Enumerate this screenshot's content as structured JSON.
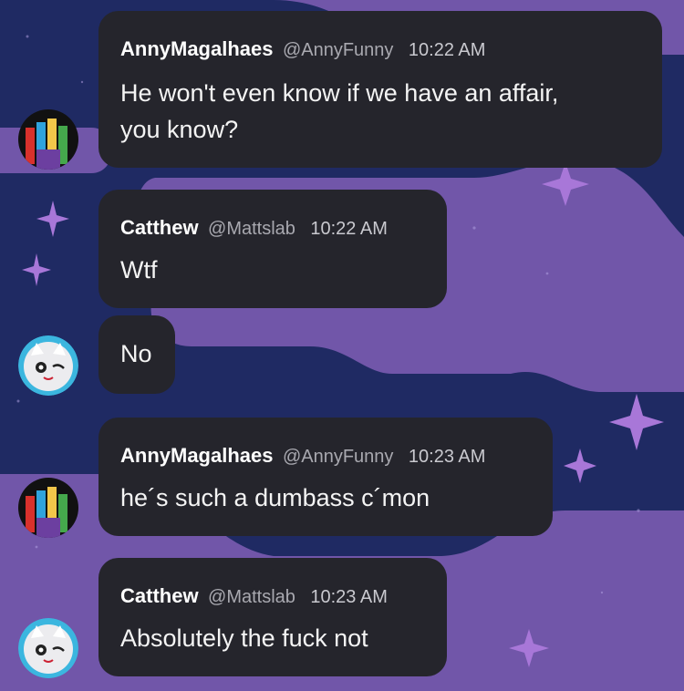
{
  "colors": {
    "background": "#1f2a63",
    "cloud": "#7a5bb0",
    "bubble": "#25252c",
    "sparkle": "#a877d8",
    "handle": "#a9a9b0"
  },
  "messages": [
    {
      "username": "AnnyMagalhaes",
      "handle": "@AnnyFunny",
      "time": "10:22 AM",
      "lines": [
        "He won't even know if we have an affair,",
        "you know?"
      ],
      "avatar_icon": "raised-hands-avatar-icon"
    },
    {
      "username": "Catthew",
      "handle": "@Mattslab",
      "time": "10:22 AM",
      "lines": [
        "Wtf"
      ]
    },
    {
      "lines": [
        "No"
      ],
      "avatar_icon": "white-cat-avatar-icon"
    },
    {
      "username": "AnnyMagalhaes",
      "handle": "@AnnyFunny",
      "time": "10:23 AM",
      "lines": [
        "he´s such a dumbass c´mon"
      ],
      "avatar_icon": "raised-hands-avatar-icon"
    },
    {
      "username": "Catthew",
      "handle": "@Mattslab",
      "time": "10:23 AM",
      "lines": [
        "Absolutely the fuck not"
      ],
      "avatar_icon": "white-cat-avatar-icon"
    }
  ]
}
